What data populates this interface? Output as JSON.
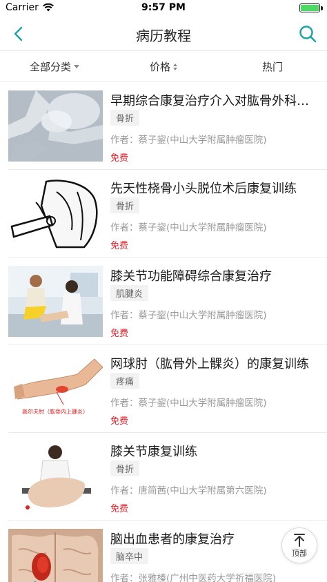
{
  "status_bar": {
    "carrier": "Carrier",
    "time": "9:57 PM",
    "battery_level": 1.0
  },
  "nav": {
    "title": "病历教程",
    "back_icon": "chevron-left-icon",
    "search_icon": "search-icon",
    "accent_color": "#1aa3a3"
  },
  "filters": [
    {
      "label": "全部分类",
      "icon": "caret-down-icon"
    },
    {
      "label": "价格",
      "icon": "sort-icon"
    },
    {
      "label": "热门"
    }
  ],
  "courses": [
    {
      "title": "早期综合康复治疗介入对肱骨外科…",
      "tag": "骨折",
      "author": "作者：蔡子鋆(中山大学附属肿瘤医院)",
      "price": "免费"
    },
    {
      "title": "先天性桡骨小头脱位术后康复训练",
      "tag": "骨折",
      "author": "作者：蔡子鋆(中山大学附属肿瘤医院)",
      "price": "免费"
    },
    {
      "title": "膝关节功能障碍综合康复治疗",
      "tag": "肌腱炎",
      "author": "作者：蔡子鋆(中山大学附属肿瘤医院)",
      "price": "免费"
    },
    {
      "title": "网球肘（肱骨外上髁炎）的康复训练",
      "tag": "疼痛",
      "author": "作者：蔡子鋆(中山大学附属肿瘤医院)",
      "price": "免费",
      "image_caption": "高尔夫肘（肱骨内上髁炎）"
    },
    {
      "title": "膝关节康复训练",
      "tag": "骨折",
      "author": "作者：唐简茜(中山大学附属第六医院)",
      "price": "免费"
    },
    {
      "title": "脑出血患者的康复治疗",
      "tag": "脑卒中",
      "author": "作者：张雅榛(广州中医药大学祈福医院)",
      "price": ""
    }
  ],
  "price_color": "#e8202a",
  "back_to_top": {
    "label": "顶部",
    "icon": "arrow-up-icon"
  }
}
